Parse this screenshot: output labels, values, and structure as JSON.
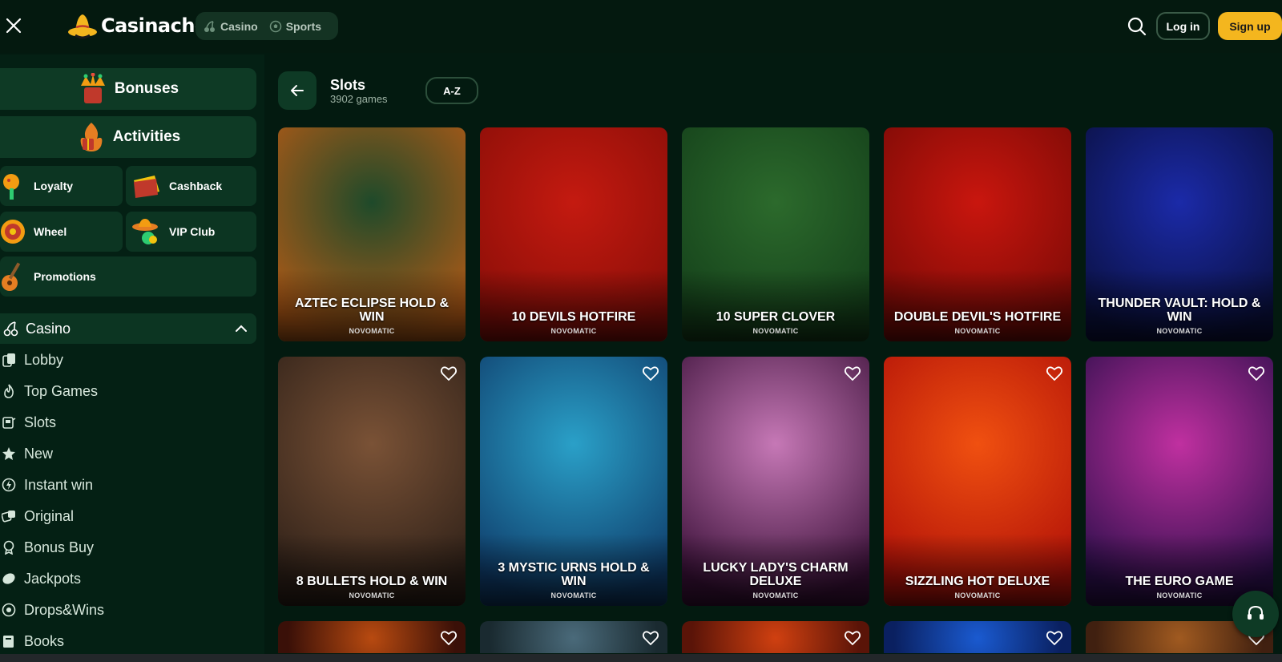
{
  "header": {
    "logo_text": "Casinacho",
    "tabs": [
      {
        "label": "Casino",
        "icon": "cherry-icon"
      },
      {
        "label": "Sports",
        "icon": "soccer-ball-icon"
      }
    ],
    "login_label": "Log in",
    "signup_label": "Sign up",
    "colors": {
      "accent": "#f4b61e",
      "background": "#04190f"
    }
  },
  "sidebar": {
    "big_buttons": [
      {
        "label": "Bonuses",
        "icon": "jester-hat-icon"
      },
      {
        "label": "Activities",
        "icon": "fire-gift-icon"
      }
    ],
    "small_buttons": [
      {
        "label": "Loyalty",
        "icon": "maraca-icon"
      },
      {
        "label": "Cashback",
        "icon": "wallet-icon"
      },
      {
        "label": "Wheel",
        "icon": "wheel-icon"
      },
      {
        "label": "VIP Club",
        "icon": "sombrero-icon"
      },
      {
        "label": "Promotions",
        "icon": "guitar-icon"
      }
    ],
    "section": {
      "label": "Casino",
      "icon": "cherry-icon"
    },
    "nav_items": [
      {
        "label": "Lobby",
        "icon": "cards-icon"
      },
      {
        "label": "Top Games",
        "icon": "flame-icon"
      },
      {
        "label": "Slots",
        "icon": "slot-machine-icon"
      },
      {
        "label": "New",
        "icon": "star-icon"
      },
      {
        "label": "Instant win",
        "icon": "lightning-icon"
      },
      {
        "label": "Original",
        "icon": "dice-icon"
      },
      {
        "label": "Bonus Buy",
        "icon": "badge-icon"
      },
      {
        "label": "Jackpots",
        "icon": "coin-icon"
      },
      {
        "label": "Drops&Wins",
        "icon": "chip-icon"
      },
      {
        "label": "Books",
        "icon": "book-icon"
      }
    ]
  },
  "main": {
    "title": "Slots",
    "subtitle": "3902 games",
    "az_label": "A-Z",
    "games": [
      {
        "title": "AZTEC ECLIPSE HOLD & WIN",
        "provider": "NOVOMATIC",
        "bg": [
          "#1e4a2a",
          "#b35a16"
        ]
      },
      {
        "title": "10 DEVILS HOTFIRE",
        "provider": "NOVOMATIC",
        "bg": [
          "#c41a10",
          "#8a0e08"
        ]
      },
      {
        "title": "10 SUPER CLOVER",
        "provider": "NOVOMATIC",
        "bg": [
          "#2c6a2c",
          "#14401a"
        ]
      },
      {
        "title": "DOUBLE DEVIL'S HOTFIRE",
        "provider": "NOVOMATIC",
        "bg": [
          "#c9160e",
          "#7a0a06"
        ]
      },
      {
        "title": "THUNDER VAULT: HOLD & WIN",
        "provider": "NOVOMATIC",
        "bg": [
          "#1b2aa8",
          "#0a1040"
        ]
      },
      {
        "title": "8 BULLETS HOLD & WIN",
        "provider": "NOVOMATIC",
        "bg": [
          "#7a5236",
          "#2e2018"
        ]
      },
      {
        "title": "3 MYSTIC URNS HOLD & WIN",
        "provider": "NOVOMATIC",
        "bg": [
          "#2aa0c8",
          "#0e3a68"
        ]
      },
      {
        "title": "LUCKY LADY'S CHARM DELUXE",
        "provider": "NOVOMATIC",
        "bg": [
          "#c678b6",
          "#3a1038"
        ]
      },
      {
        "title": "SIZZLING HOT DELUXE",
        "provider": "NOVOMATIC",
        "bg": [
          "#f05010",
          "#b01008"
        ]
      },
      {
        "title": "THE EURO GAME",
        "provider": "NOVOMATIC",
        "bg": [
          "#c030a0",
          "#2a0e4a"
        ]
      },
      {
        "title": "",
        "provider": "",
        "bg": [
          "#b84a10",
          "#3a1008"
        ]
      },
      {
        "title": "",
        "provider": "",
        "bg": [
          "#4a6a7a",
          "#1a2a30"
        ]
      },
      {
        "title": "",
        "provider": "",
        "bg": [
          "#d04010",
          "#5a1408"
        ]
      },
      {
        "title": "",
        "provider": "",
        "bg": [
          "#1a5ad0",
          "#0a2060"
        ]
      },
      {
        "title": "",
        "provider": "",
        "bg": [
          "#a05a20",
          "#402010"
        ]
      }
    ]
  }
}
